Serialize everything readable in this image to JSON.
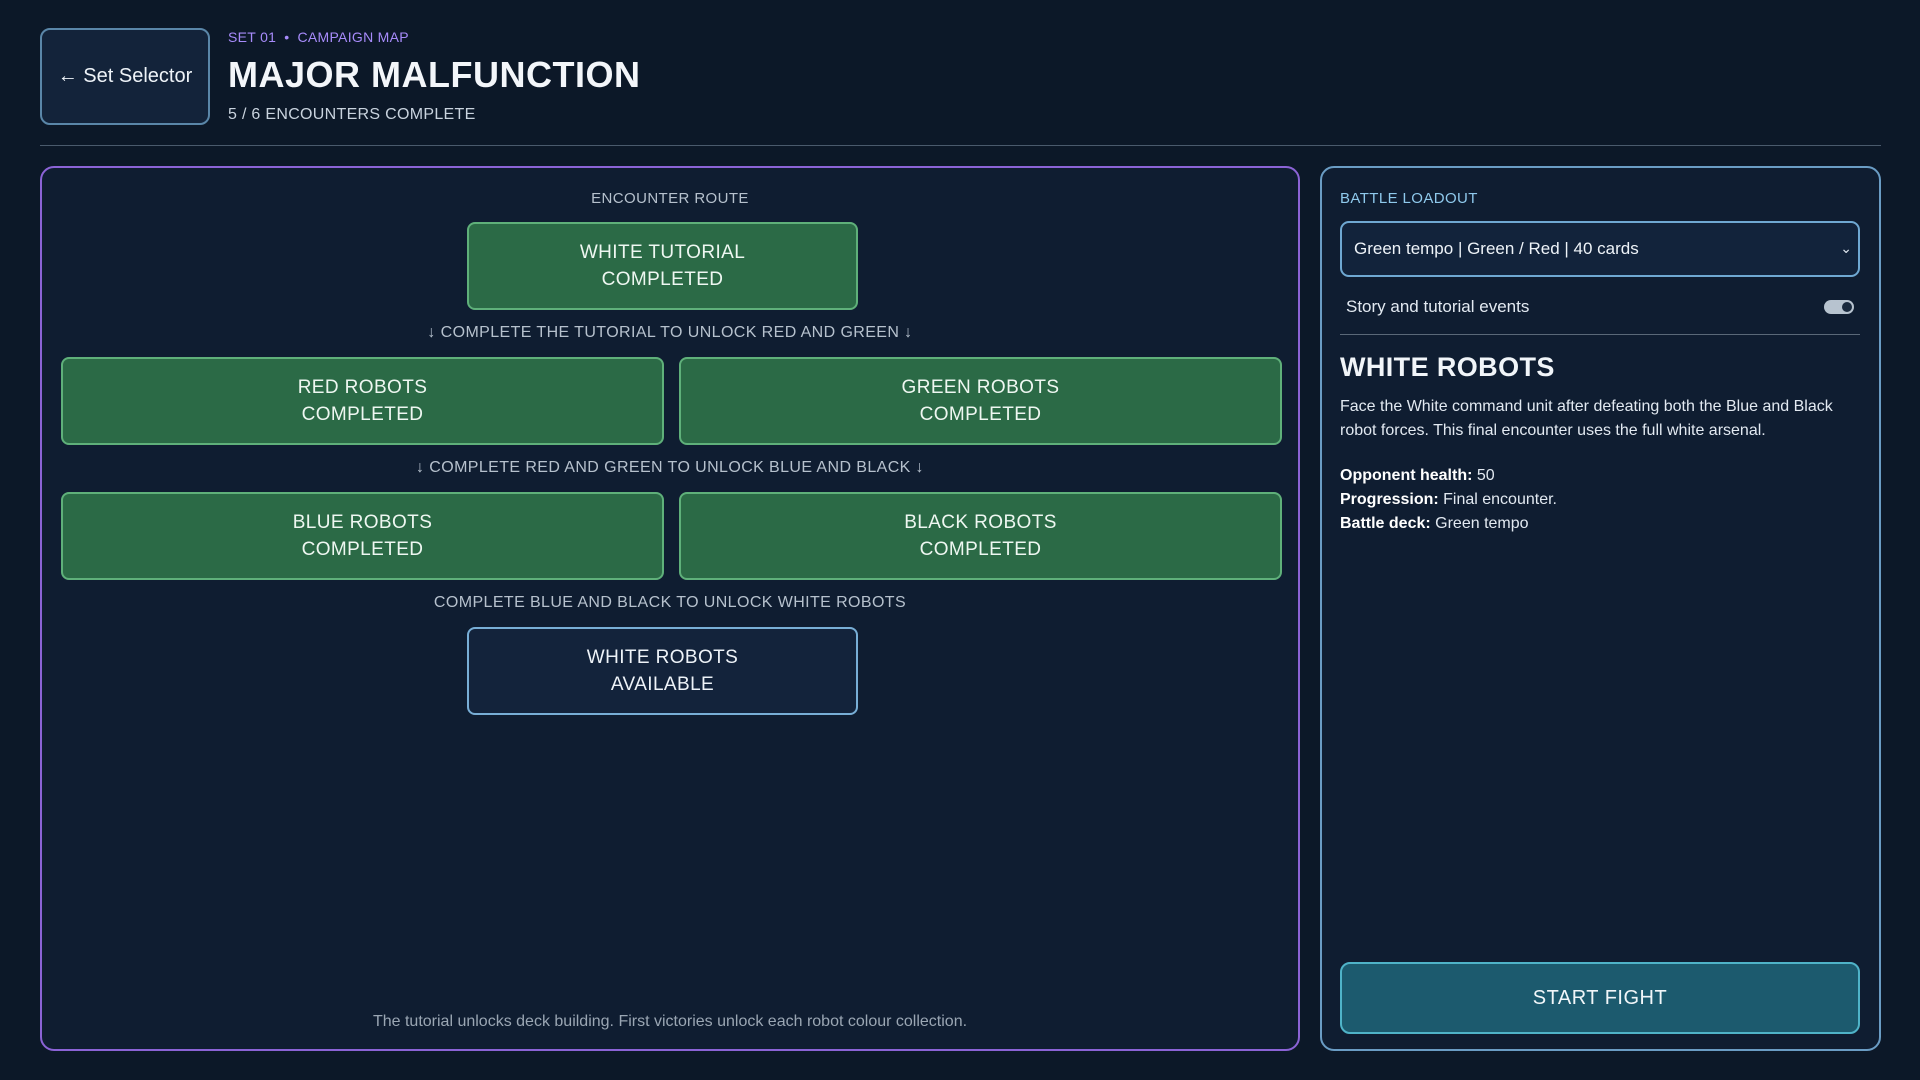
{
  "header": {
    "back_label": "← Set Selector",
    "set_label": "SET 01",
    "separator": "•",
    "section_label": "CAMPAIGN MAP",
    "title": "MAJOR MALFUNCTION",
    "progress": "5 / 6 ENCOUNTERS COMPLETE"
  },
  "map": {
    "route_heading": "ENCOUNTER ROUTE",
    "nodes": [
      {
        "name": "WHITE TUTORIAL",
        "status": "COMPLETED"
      },
      {
        "name": "RED ROBOTS",
        "status": "COMPLETED"
      },
      {
        "name": "GREEN ROBOTS",
        "status": "COMPLETED"
      },
      {
        "name": "BLUE ROBOTS",
        "status": "COMPLETED"
      },
      {
        "name": "BLACK ROBOTS",
        "status": "COMPLETED"
      },
      {
        "name": "WHITE ROBOTS",
        "status": "AVAILABLE"
      }
    ],
    "hints": [
      "↓  COMPLETE THE TUTORIAL TO UNLOCK RED AND GREEN  ↓",
      "↓  COMPLETE RED AND GREEN TO UNLOCK BLUE AND BLACK  ↓",
      "COMPLETE BLUE AND BLACK TO UNLOCK WHITE ROBOTS"
    ],
    "footer": "The tutorial unlocks deck building. First victories unlock each robot colour collection."
  },
  "sidebar": {
    "loadout_heading": "BATTLE LOADOUT",
    "deck_value": "Green tempo | Green / Red | 40 cards",
    "toggle_label": "Story and tutorial events",
    "toggle_on": true,
    "encounter_title": "WHITE ROBOTS",
    "encounter_description": "Face the White command unit after defeating both the Blue and Black robot forces. This final encounter uses the full white arsenal.",
    "stats": [
      {
        "key": "Opponent health:",
        "value": " 50"
      },
      {
        "key": "Progression:",
        "value": " Final encounter."
      },
      {
        "key": "Battle deck:",
        "value": " Green tempo"
      }
    ],
    "start_label": "START FIGHT"
  },
  "colors": {
    "background": "#0c1828",
    "completed": "#2b6a46",
    "available_border": "#78aed6",
    "map_border": "#8b63d6",
    "accent_violet": "#a78bfa",
    "start_button": "#1c5a6e"
  }
}
